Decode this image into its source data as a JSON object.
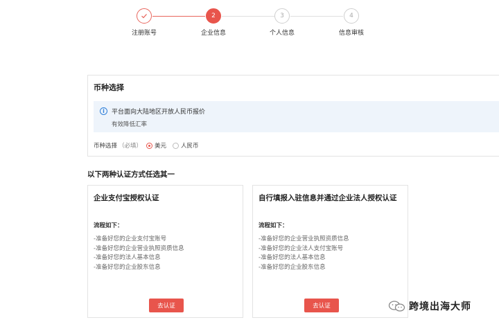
{
  "stepper": {
    "steps": [
      {
        "number": "",
        "label": "注册账号",
        "state": "done"
      },
      {
        "number": "2",
        "label": "企业信息",
        "state": "active"
      },
      {
        "number": "3",
        "label": "个人信息",
        "state": "todo"
      },
      {
        "number": "4",
        "label": "信息审核",
        "state": "todo"
      }
    ]
  },
  "currency": {
    "title": "币种选择",
    "info_line1": "平台面向大陆地区开放人民币报价",
    "info_line2": "有效降低汇率",
    "field_label": "币种选择",
    "required_hint": "（必填）",
    "options": [
      {
        "label": "美元",
        "selected": true
      },
      {
        "label": "人民币",
        "selected": false
      }
    ]
  },
  "auth_section": {
    "heading": "以下两种认证方式任选其一",
    "cards": [
      {
        "title": "企业支付宝授权认证",
        "process_title": "流程如下：",
        "steps": [
          "-准备好您的企业支付宝账号",
          "-准备好您的企业营业执照资质信息",
          "-准备好您的法人基本信息",
          "-准备好您的企业股东信息"
        ],
        "button": "去认证"
      },
      {
        "title": "自行填报入驻信息并通过企业法人授权认证",
        "process_title": "流程如下：",
        "steps": [
          "-准备好您的企业营业执照资质信息",
          "-准备好您的企业法人支付宝账号",
          "-准备好您的法人基本信息",
          "-准备好您的企业股东信息"
        ],
        "button": "去认证"
      }
    ]
  },
  "watermark": {
    "text": "跨境出海大师"
  },
  "colors": {
    "accent": "#e8554c",
    "info_bg": "#eef4fb",
    "info_icon": "#2f7fd8"
  }
}
